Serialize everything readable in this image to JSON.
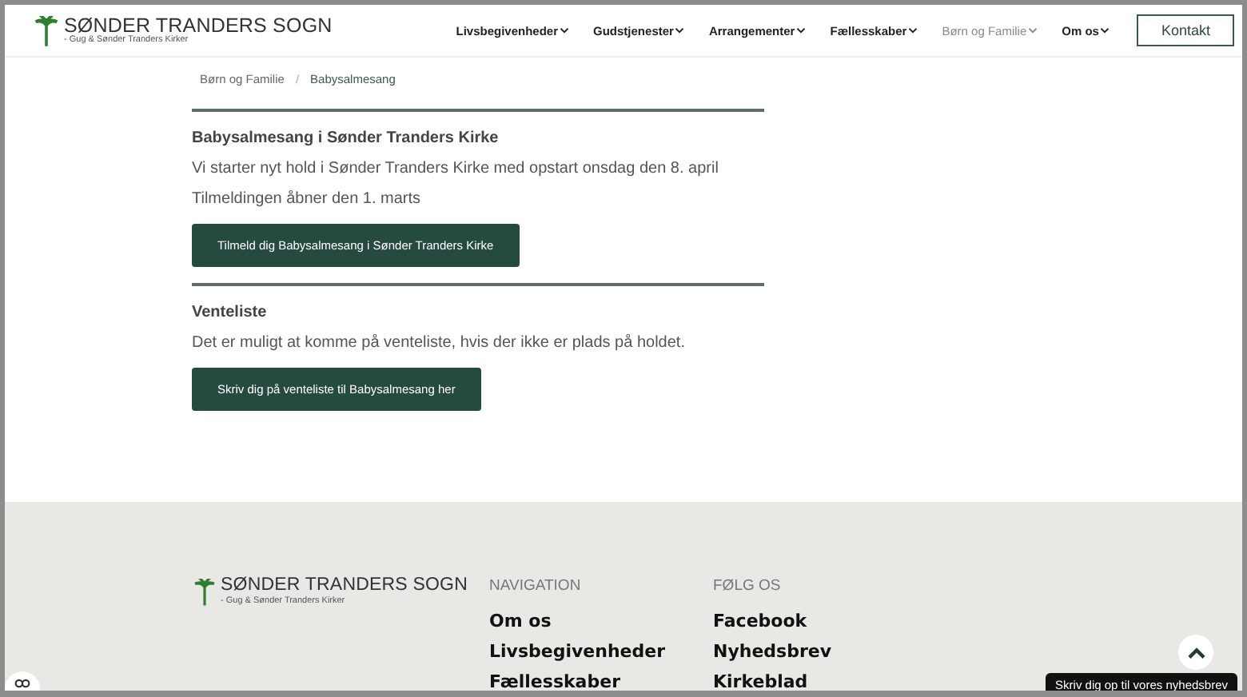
{
  "header": {
    "logo": {
      "title": "SØNDER TRANDERS SOGN",
      "subtitle": "- Gug & Sønder Tranders Kirker"
    },
    "nav": [
      {
        "label": "Livsbegivenheder",
        "selected": false
      },
      {
        "label": "Gudstjenester",
        "selected": false
      },
      {
        "label": "Arrangementer",
        "selected": false
      },
      {
        "label": "Fællesskaber",
        "selected": false
      },
      {
        "label": "Børn og Familie",
        "selected": true
      },
      {
        "label": "Om os",
        "selected": false
      }
    ],
    "contact_button": "Kontakt"
  },
  "breadcrumb": {
    "items": [
      "Børn og Familie",
      "Babysalmesang"
    ],
    "separator": "/"
  },
  "sections": [
    {
      "heading": "Babysalmesang i Sønder Tranders Kirke",
      "paragraphs": [
        "Vi starter nyt hold i Sønder Tranders Kirke med opstart onsdag den 8. april",
        "Tilmeldingen åbner den 1. marts"
      ],
      "button": "Tilmeld dig Babysalmesang i Sønder Tranders Kirke"
    },
    {
      "heading": "Venteliste",
      "paragraphs": [
        "Det er muligt at komme på venteliste, hvis der ikke er plads på holdet."
      ],
      "button": "Skriv dig på venteliste til Babysalmesang her"
    }
  ],
  "footer": {
    "logo": {
      "title": "SØNDER TRANDERS SOGN",
      "subtitle": "- Gug & Sønder Tranders Kirker"
    },
    "columns": [
      {
        "heading": "NAVIGATION",
        "links": [
          "Om os",
          "Livsbegivenheder",
          "Fællesskaber"
        ]
      },
      {
        "heading": "FØLG OS",
        "links": [
          "Facebook",
          "Nyhedsbrev",
          "Kirkeblad"
        ]
      }
    ]
  },
  "newsletter_tooltip": "Skriv dig op til vores nyhedsbrev"
}
